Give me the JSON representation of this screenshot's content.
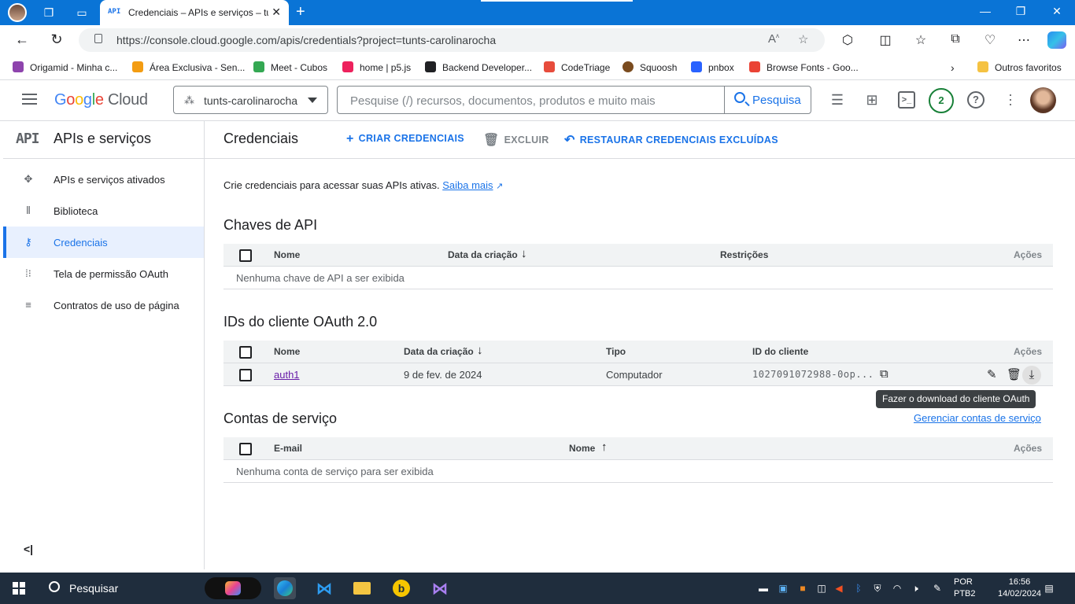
{
  "browser": {
    "tab_title": "Credenciais – APIs e serviços – tunts-carolinarocha",
    "tab_favicon": "API",
    "url": "https://console.cloud.google.com/apis/credentials?project=tunts-carolinarocha",
    "favorites": [
      {
        "label": "Origamid - Minha c...",
        "color": "#8e44ad"
      },
      {
        "label": "Área Exclusiva - Sen...",
        "color": "#f39c12"
      },
      {
        "label": "Meet - Cubos",
        "color": "#34a853"
      },
      {
        "label": "home | p5.js",
        "color": "#ed225d"
      },
      {
        "label": "Backend Developer...",
        "color": "#202124"
      },
      {
        "label": "CodeTriage",
        "color": "#e74c3c"
      },
      {
        "label": "Squoosh",
        "color": "#7a4b1f"
      },
      {
        "label": "pnbox",
        "color": "#2962ff"
      },
      {
        "label": "Browse Fonts - Goo...",
        "color": "#ea4335"
      }
    ],
    "other_favorites": "Outros favoritos"
  },
  "header": {
    "logo_google": "Google",
    "logo_cloud": "Cloud",
    "project": "tunts-carolinarocha",
    "search_placeholder": "Pesquise (/) recursos, documentos, produtos e muito mais",
    "search_button": "Pesquisa",
    "notifications_count": "2"
  },
  "sidebar": {
    "logo": "API",
    "title": "APIs e serviços",
    "items": [
      {
        "label": "APIs e serviços ativados",
        "icon": "enabled-apis-icon"
      },
      {
        "label": "Biblioteca",
        "icon": "library-icon"
      },
      {
        "label": "Credenciais",
        "icon": "key-icon",
        "active": true
      },
      {
        "label": "Tela de permissão OAuth",
        "icon": "oauth-consent-icon"
      },
      {
        "label": "Contratos de uso de página",
        "icon": "page-usage-agreements-icon"
      }
    ],
    "collapse_glyph": "<|"
  },
  "main": {
    "title": "Credenciais",
    "toolbar": {
      "create": "CRIAR CREDENCIAIS",
      "delete": "EXCLUIR",
      "restore": "RESTAURAR CREDENCIAIS EXCLUÍDAS"
    },
    "intro_text": "Crie credenciais para acessar suas APIs ativas.",
    "intro_link": "Saiba mais",
    "api_keys": {
      "title": "Chaves de API",
      "columns": {
        "name": "Nome",
        "created": "Data da criação",
        "restrictions": "Restrições",
        "actions": "Ações"
      },
      "empty": "Nenhuma chave de API a ser exibida"
    },
    "oauth": {
      "title": "IDs do cliente OAuth 2.0",
      "columns": {
        "name": "Nome",
        "created": "Data da criação",
        "type": "Tipo",
        "client_id": "ID do cliente",
        "actions": "Ações"
      },
      "rows": [
        {
          "name": "auth1",
          "created": "9 de fev. de 2024",
          "type": "Computador",
          "client_id": "1027091072988-0op..."
        }
      ],
      "tooltip": "Fazer o download do cliente OAuth"
    },
    "service_accounts": {
      "title": "Contas de serviço",
      "manage_link": "Gerenciar contas de serviço",
      "columns": {
        "email": "E-mail",
        "name": "Nome",
        "actions": "Ações"
      },
      "empty": "Nenhuma conta de serviço para ser exibida"
    }
  },
  "taskbar": {
    "search": "Pesquisar",
    "lang_line1": "POR",
    "lang_line2": "PTB2",
    "time": "16:56",
    "date": "14/02/2024"
  }
}
